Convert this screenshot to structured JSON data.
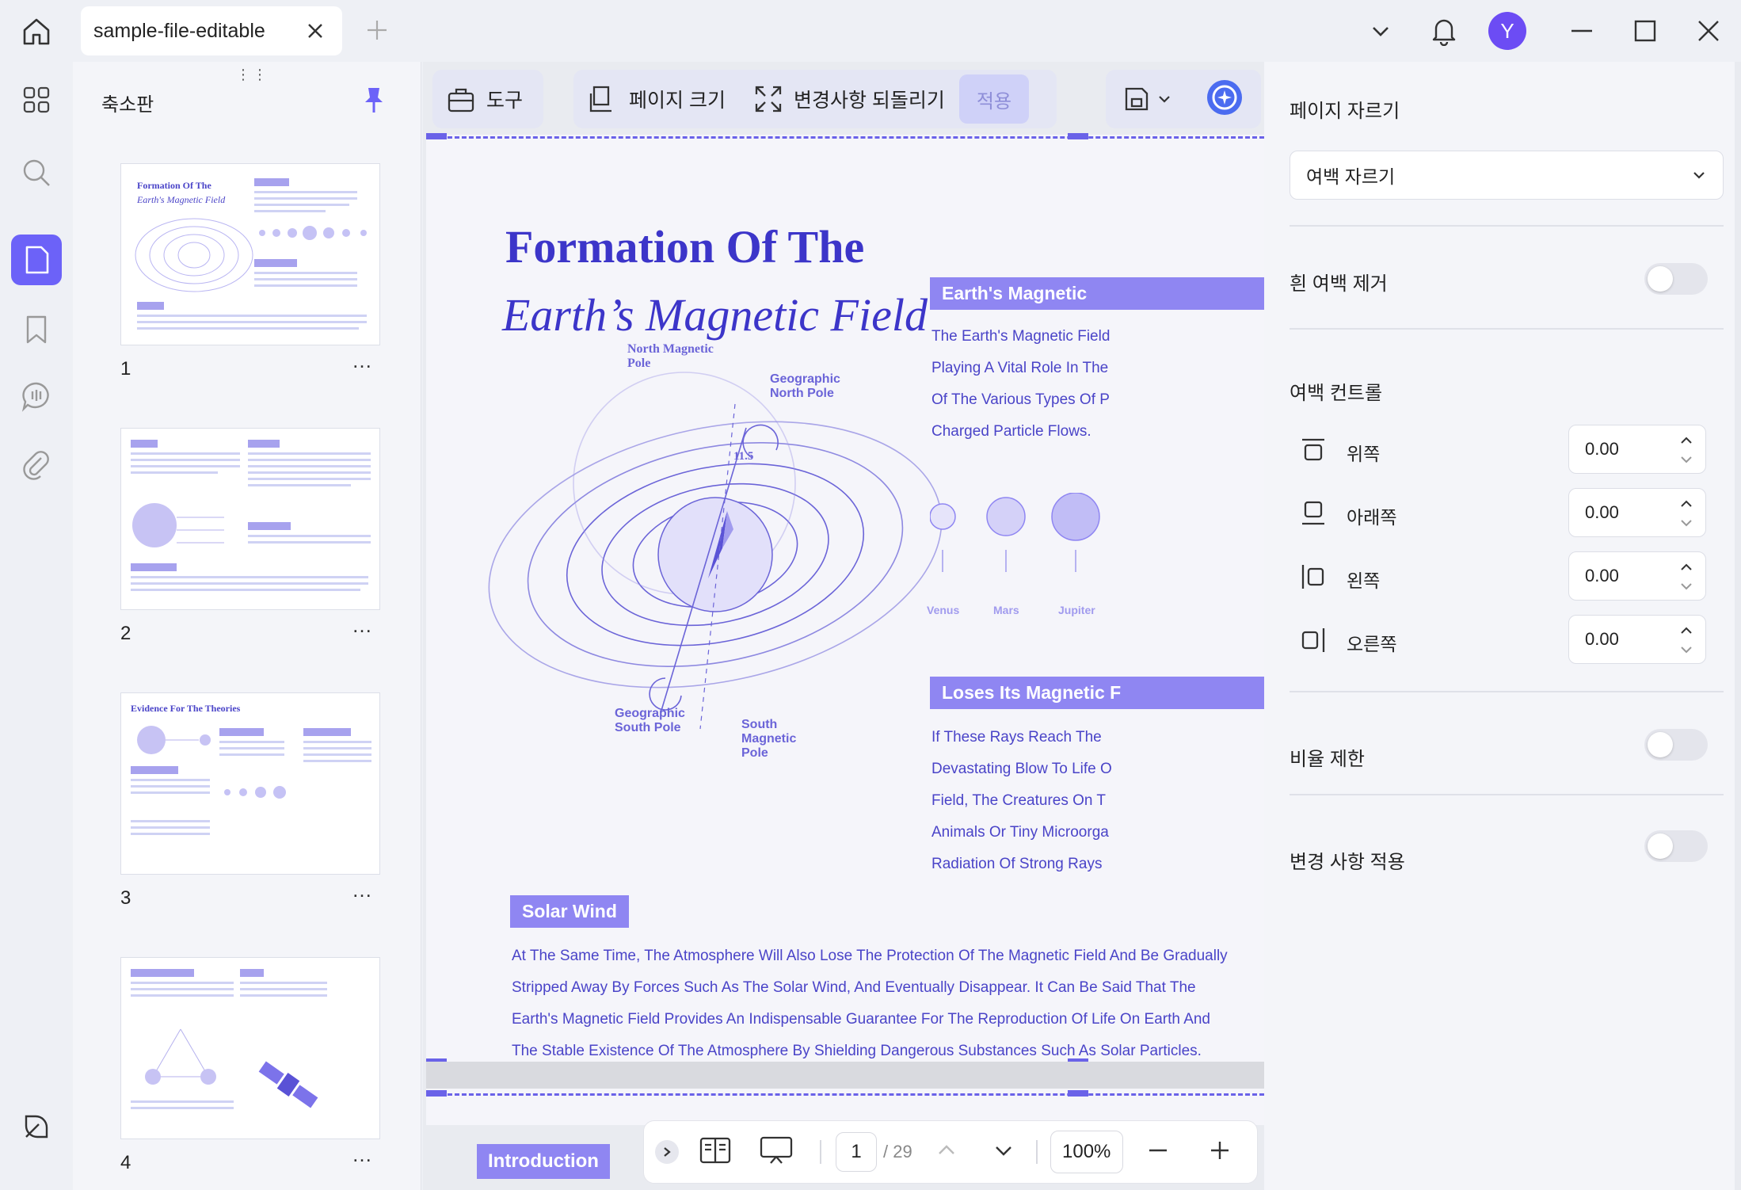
{
  "tab": {
    "title": "sample-file-editable"
  },
  "thumbnails": {
    "title": "축소판",
    "pages": [
      {
        "number": "1",
        "heading": "Formation Of The",
        "subheading": "Earth's Magnetic Field"
      },
      {
        "number": "2"
      },
      {
        "number": "3",
        "heading": "Evidence For The Theories"
      },
      {
        "number": "4"
      }
    ]
  },
  "toolbar": {
    "tools": "도구",
    "page_size": "페이지 크기",
    "revert": "변경사항 되돌리기",
    "apply": "적용"
  },
  "document": {
    "title_line1": "Formation Of The",
    "title_line2": "Earth’s Magnetic Field",
    "sec_earth": "Earth's Magnetic",
    "earth_lines": [
      "The Earth's Magnetic Field",
      "Playing A Vital Role In The",
      "Of The Various Types Of P",
      "Charged Particle Flows."
    ],
    "planets": [
      "Venus",
      "Mars",
      "Jupiter"
    ],
    "sec_loses": "Loses Its Magnetic F",
    "loses_lines": [
      "If These Rays Reach The",
      "Devastating Blow To Life O",
      "Field, The Creatures On T",
      "Animals Or Tiny Microorga",
      "Radiation Of Strong Rays"
    ],
    "diagram": {
      "north_magnetic": "North Magnetic Pole",
      "geo_north": "Geographic North Pole",
      "geo_south": "Geographic South Pole",
      "south_magnetic": "South Magnetic Pole",
      "angle": "11.5"
    },
    "sec_solar": "Solar Wind",
    "solar_lines": [
      "At The Same Time, The Atmosphere Will Also Lose The Protection Of The Magnetic Field And Be Gradually",
      "Stripped Away By Forces Such As The Solar Wind, And Eventually Disappear. It Can Be Said That The",
      "Earth's Magnetic Field Provides An Indispensable Guarantee For The Reproduction Of Life On Earth And",
      "The Stable Existence Of The Atmosphere By Shielding Dangerous Substances Such As Solar Particles."
    ],
    "intro_tag": "Introduction"
  },
  "navigation": {
    "current_page": "1",
    "total_pages": "/ 29",
    "zoom": "100%"
  },
  "crop_panel": {
    "title": "페이지 자르기",
    "mode": "여백 자르기",
    "remove_white_margin": "흰 여백 제거",
    "margin_control": "여백 컨트롤",
    "margins": [
      {
        "label": "위쪽",
        "value": "0.00"
      },
      {
        "label": "아래쪽",
        "value": "0.00"
      },
      {
        "label": "왼쪽",
        "value": "0.00"
      },
      {
        "label": "오른쪽",
        "value": "0.00"
      }
    ],
    "ratio_limit": "비율 제한",
    "apply_changes": "변경 사항 적용"
  },
  "user": {
    "initial": "Y"
  },
  "colors": {
    "accent": "#6c62f8",
    "doc_blue": "#3c35c9",
    "section": "#8f86f2",
    "avatar": "#6c4cf4"
  }
}
